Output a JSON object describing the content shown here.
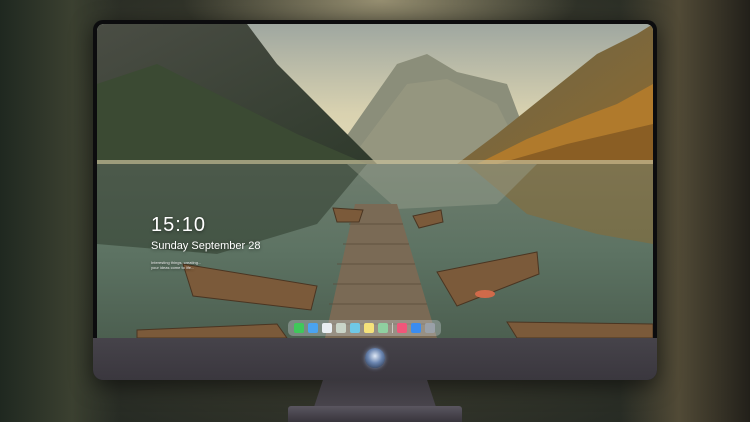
{
  "lock_screen": {
    "time": "15:10",
    "date": "Sunday September 28",
    "notice_line_1": "Interesting things, creating...",
    "notice_line_2": "your ideas come to life..."
  },
  "dock": {
    "icons": [
      {
        "name": "messages-icon",
        "color": "#3fc85a"
      },
      {
        "name": "finder-icon",
        "color": "#4aa3f0"
      },
      {
        "name": "safari-icon",
        "color": "#e9eef3"
      },
      {
        "name": "preview-icon",
        "color": "#c9d4c8"
      },
      {
        "name": "claquette-icon",
        "color": "#6fc8e6"
      },
      {
        "name": "notes-icon",
        "color": "#f5e27a"
      },
      {
        "name": "photos-icon",
        "color": "#8fd0a0"
      },
      {
        "name": "music-icon",
        "color": "#f0567a"
      },
      {
        "name": "app-store-icon",
        "color": "#3b8cf0"
      },
      {
        "name": "system-settings-icon",
        "color": "#9aa0a8"
      }
    ]
  },
  "colors": {
    "sky": "#dcd3b0",
    "lake": "#6d8472",
    "forest_autumn": "#b37a2b",
    "boat": "#8b6a45",
    "monitor_chin": "#3f3c44"
  }
}
